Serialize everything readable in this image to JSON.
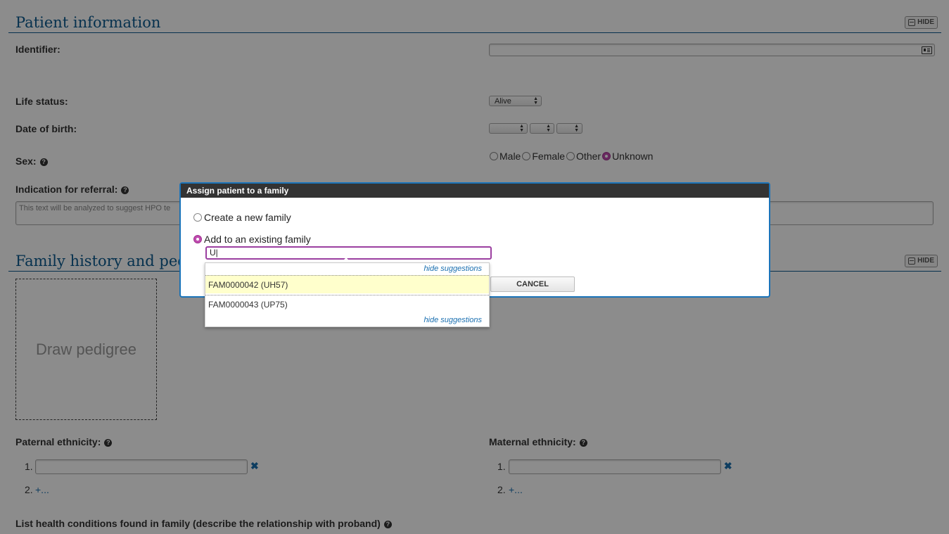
{
  "patient_info": {
    "title": "Patient information",
    "hide_label": "HIDE",
    "identifier_label": "Identifier:",
    "life_status_label": "Life status:",
    "life_status_value": "Alive",
    "dob_label": "Date of birth:",
    "sex_label": "Sex:",
    "sex_options": [
      "Male",
      "Female",
      "Other",
      "Unknown"
    ],
    "sex_selected": "Unknown",
    "referral_label": "Indication for referral:",
    "referral_placeholder": "This text will be analyzed to suggest HPO te"
  },
  "family_history": {
    "title": "Family history and pedigr",
    "hide_label": "HIDE",
    "draw_pedigree": "Draw pedigree",
    "paternal_label": "Paternal ethnicity:",
    "maternal_label": "Maternal ethnicity:",
    "item1_num": "1.",
    "item2_num": "2.",
    "add_more": "+...",
    "conditions_label": "List health conditions found in family (describe the relationship with proband)"
  },
  "dialog": {
    "title": "Assign patient to a family",
    "option_new": "Create a new family",
    "option_existing": "Add to an existing family",
    "selected_option": "existing",
    "search_value": "U|",
    "cancel_label": "CANCEL"
  },
  "suggestions": {
    "hide_label": "hide suggestions",
    "items": [
      "FAM0000042 (UH57)",
      "FAM0000043 (UP75)"
    ],
    "active_index": 0
  },
  "colors": {
    "accent": "#0b5a8f",
    "radio_selected": "#c04bb0",
    "link": "#1a6fb0"
  }
}
